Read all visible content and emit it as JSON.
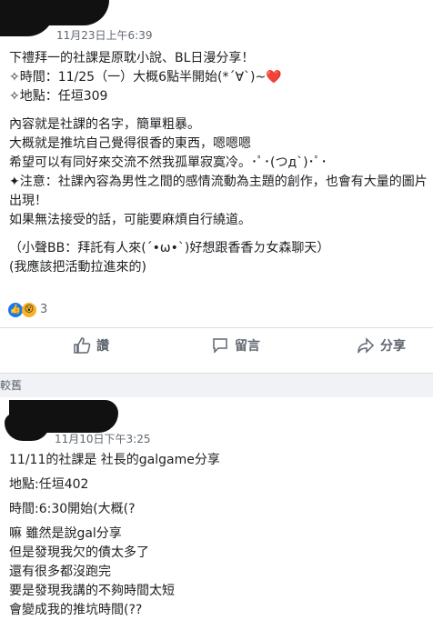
{
  "post1": {
    "timestamp": "11月23日上午6:39",
    "lines": [
      "下禮拜一的社課是原耽小說、BL日漫分享！",
      "✧時間：11/25（一）大概6點半開始(*´∀`)~❤️",
      "✧地點：任垣309",
      "內容就是社課的名字，簡單粗暴。",
      "大概就是推坑自己覺得很香的東西，嗯嗯嗯",
      "希望可以有同好來交流不然我孤單寂寞冷。･ﾟ･(つд`)･ﾟ･",
      "✦注意：社課內容為男性之間的感情流動為主題的創作，也會有大量的圖片出現！",
      "如果無法接受的話，可能要麻煩自行繞道。",
      "（小聲BB：拜託有人來(ˊ•ω•ˋ)好想跟香香ㄉ女森聊天）",
      "(我應該把活動拉進來的)"
    ],
    "reaction_count": "3",
    "actions": {
      "like": "讚",
      "comment": "留言",
      "share": "分享"
    }
  },
  "section_label": "較舊",
  "post2": {
    "timestamp": "11月10日下午3:25",
    "lines": [
      "11/11的社課是 社長的galgame分享",
      "地點:任垣402",
      "時間:6:30開始(大概(?",
      "嘛 雖然是說gal分享",
      "但是發現我欠的債太多了",
      "還有很多都沒跑完",
      "要是發現我講的不夠時間太短",
      "會變成我的推坑時間(??"
    ]
  },
  "colors": {
    "accent": "#1877f2",
    "muted": "#606770",
    "divider": "#dadde1",
    "bg_grey": "#f0f2f5"
  }
}
